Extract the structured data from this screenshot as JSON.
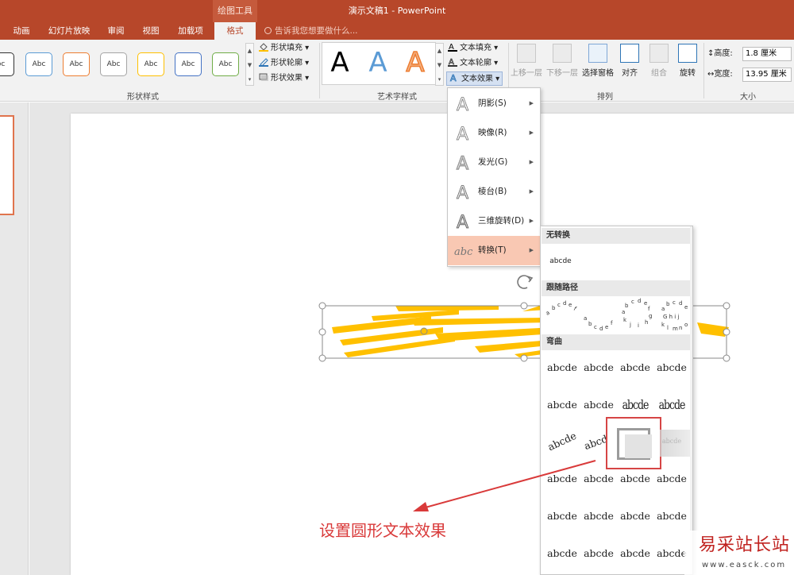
{
  "window": {
    "context_tool": "绘图工具",
    "title": "演示文稿1 - PowerPoint"
  },
  "tabs": [
    "动画",
    "幻灯片放映",
    "审阅",
    "视图",
    "加载项",
    "格式"
  ],
  "tell_me": "告诉我您想要做什么...",
  "ribbon": {
    "shape_styles": {
      "label": "形状样式",
      "buttons": [
        "bc",
        "Abc",
        "Abc",
        "Abc",
        "Abc",
        "Abc",
        "Abc"
      ],
      "fill": "形状填充",
      "outline": "形状轮廓",
      "effects": "形状效果"
    },
    "wordart": {
      "label": "艺术字样式",
      "samples": [
        "A",
        "A",
        "A"
      ],
      "text_fill": "文本填充",
      "text_outline": "文本轮廓",
      "text_effects": "文本效果"
    },
    "arrange": {
      "label": "排列",
      "bring_forward": "上移一层",
      "send_backward": "下移一层",
      "selection_pane": "选择窗格",
      "align": "对齐",
      "group": "组合",
      "rotate": "旋转"
    },
    "size": {
      "label": "大小",
      "height_label": "高度:",
      "height_value": "1.8 厘米",
      "width_label": "宽度:",
      "width_value": "13.95 厘米"
    }
  },
  "effects_menu": {
    "items": [
      {
        "label": "阴影(S)"
      },
      {
        "label": "映像(R)"
      },
      {
        "label": "发光(G)"
      },
      {
        "label": "棱台(B)"
      },
      {
        "label": "三维旋转(D)"
      },
      {
        "label": "转换(T)"
      }
    ]
  },
  "transform_panel": {
    "no_transform": "无转换",
    "no_transform_sample": "abcde",
    "follow_path": "跟随路径",
    "warp": "弯曲",
    "warp_samples": [
      "abcde",
      "abcde",
      "abcde",
      "abcde",
      "abcde",
      "abcde",
      "abcde",
      "abcde",
      "abcde",
      "abcde",
      "abcde",
      "abcde",
      "abcde",
      "abcde",
      "abcde",
      "abcde",
      "abcde",
      "abcde",
      "abcde",
      "abcde",
      "abcde",
      "abcde",
      "abcde",
      "abcde"
    ]
  },
  "annotation": "设置圆形文本效果",
  "watermark": {
    "main": "易采站长站",
    "sub": "www.easck.com"
  },
  "colors": {
    "accent": "#b7472a",
    "menu_highlight": "#f9c8b3",
    "annotation": "#d93a3a",
    "wordart_orange": "#ffc000"
  }
}
